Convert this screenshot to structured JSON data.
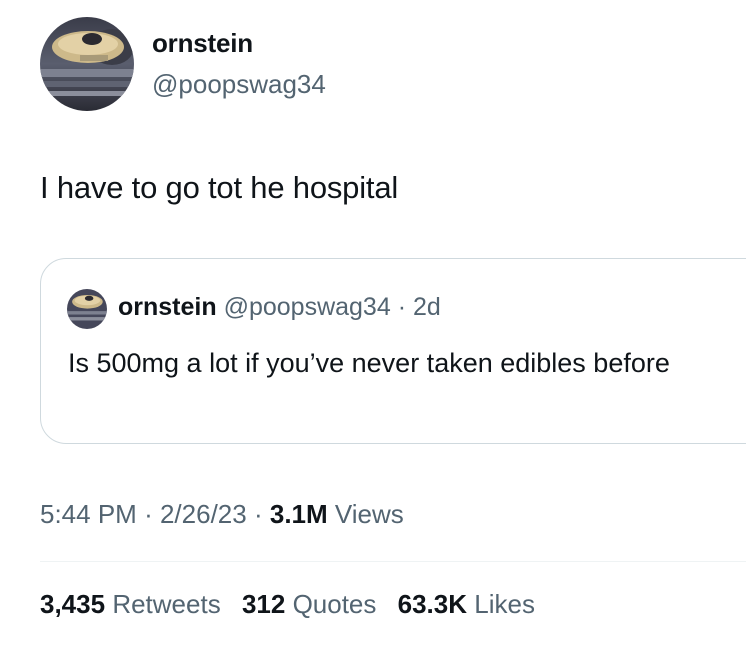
{
  "author": {
    "name": "ornstein",
    "handle": "@poopswag34"
  },
  "tweet": {
    "text": "I have to go tot he hospital"
  },
  "quoted_tweet": {
    "name": "ornstein",
    "handle": "@poopswag34",
    "separator": "·",
    "age": "2d",
    "text": "Is 500mg a lot if you’ve never taken edibles before"
  },
  "meta": {
    "time": "5:44 PM",
    "separator": "·",
    "date": "2/26/23",
    "views_count": "3.1M",
    "views_label": "Views"
  },
  "stats": [
    {
      "count": "3,435",
      "label": "Retweets"
    },
    {
      "count": "312",
      "label": "Quotes"
    },
    {
      "count": "63.3K",
      "label": "Likes"
    }
  ],
  "colors": {
    "text_primary": "#0f1419",
    "text_secondary": "#536471",
    "border": "#cfd9de",
    "divider": "#eff3f4"
  }
}
